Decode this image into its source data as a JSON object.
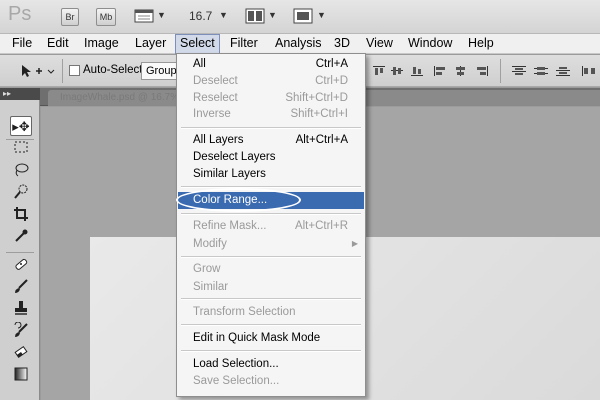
{
  "app": {
    "logo": "Ps",
    "bridge_label": "Br",
    "minibridge_label": "Mb",
    "zoom": "16.7"
  },
  "menubar": {
    "file": "File",
    "edit": "Edit",
    "image": "Image",
    "layer": "Layer",
    "select": "Select",
    "filter": "Filter",
    "analysis": "Analysis",
    "3d": "3D",
    "view": "View",
    "window": "Window",
    "help": "Help"
  },
  "options": {
    "auto_select_label": "Auto-Select:",
    "auto_select_checked": false,
    "group_value": "Group"
  },
  "document": {
    "title": "ImageWhale.psd @ 16.7% (Layer 0, RGB/8)"
  },
  "select_menu": {
    "items": [
      {
        "label": "All",
        "shortcut": "Ctrl+A",
        "disabled": false
      },
      {
        "label": "Deselect",
        "shortcut": "Ctrl+D",
        "disabled": true
      },
      {
        "label": "Reselect",
        "shortcut": "Shift+Ctrl+D",
        "disabled": true
      },
      {
        "label": "Inverse",
        "shortcut": "Shift+Ctrl+I",
        "disabled": true
      },
      {
        "label": "All Layers",
        "shortcut": "Alt+Ctrl+A",
        "disabled": false
      },
      {
        "label": "Deselect Layers",
        "shortcut": "",
        "disabled": false
      },
      {
        "label": "Similar Layers",
        "shortcut": "",
        "disabled": false
      },
      {
        "label": "Color Range...",
        "shortcut": "",
        "disabled": false,
        "highlighted": true
      },
      {
        "label": "Refine Mask...",
        "shortcut": "Alt+Ctrl+R",
        "disabled": true
      },
      {
        "label": "Modify",
        "shortcut": "",
        "disabled": true,
        "submenu": true
      },
      {
        "label": "Grow",
        "shortcut": "",
        "disabled": true
      },
      {
        "label": "Similar",
        "shortcut": "",
        "disabled": true
      },
      {
        "label": "Transform Selection",
        "shortcut": "",
        "disabled": true
      },
      {
        "label": "Edit in Quick Mask Mode",
        "shortcut": "",
        "disabled": false
      },
      {
        "label": "Load Selection...",
        "shortcut": "",
        "disabled": false
      },
      {
        "label": "Save Selection...",
        "shortcut": "",
        "disabled": true
      }
    ]
  },
  "tools": [
    "move-tool",
    "marquee-tool",
    "lasso-tool",
    "quick-selection-tool",
    "crop-tool",
    "eyedropper-tool",
    "healing-brush-tool",
    "brush-tool",
    "clone-stamp-tool",
    "history-brush-tool",
    "eraser-tool",
    "gradient-tool"
  ],
  "colors": {
    "highlight": "#3a6ab0",
    "disabled_text": "#9a9a9a",
    "menu_bg": "#f5f5f5"
  }
}
